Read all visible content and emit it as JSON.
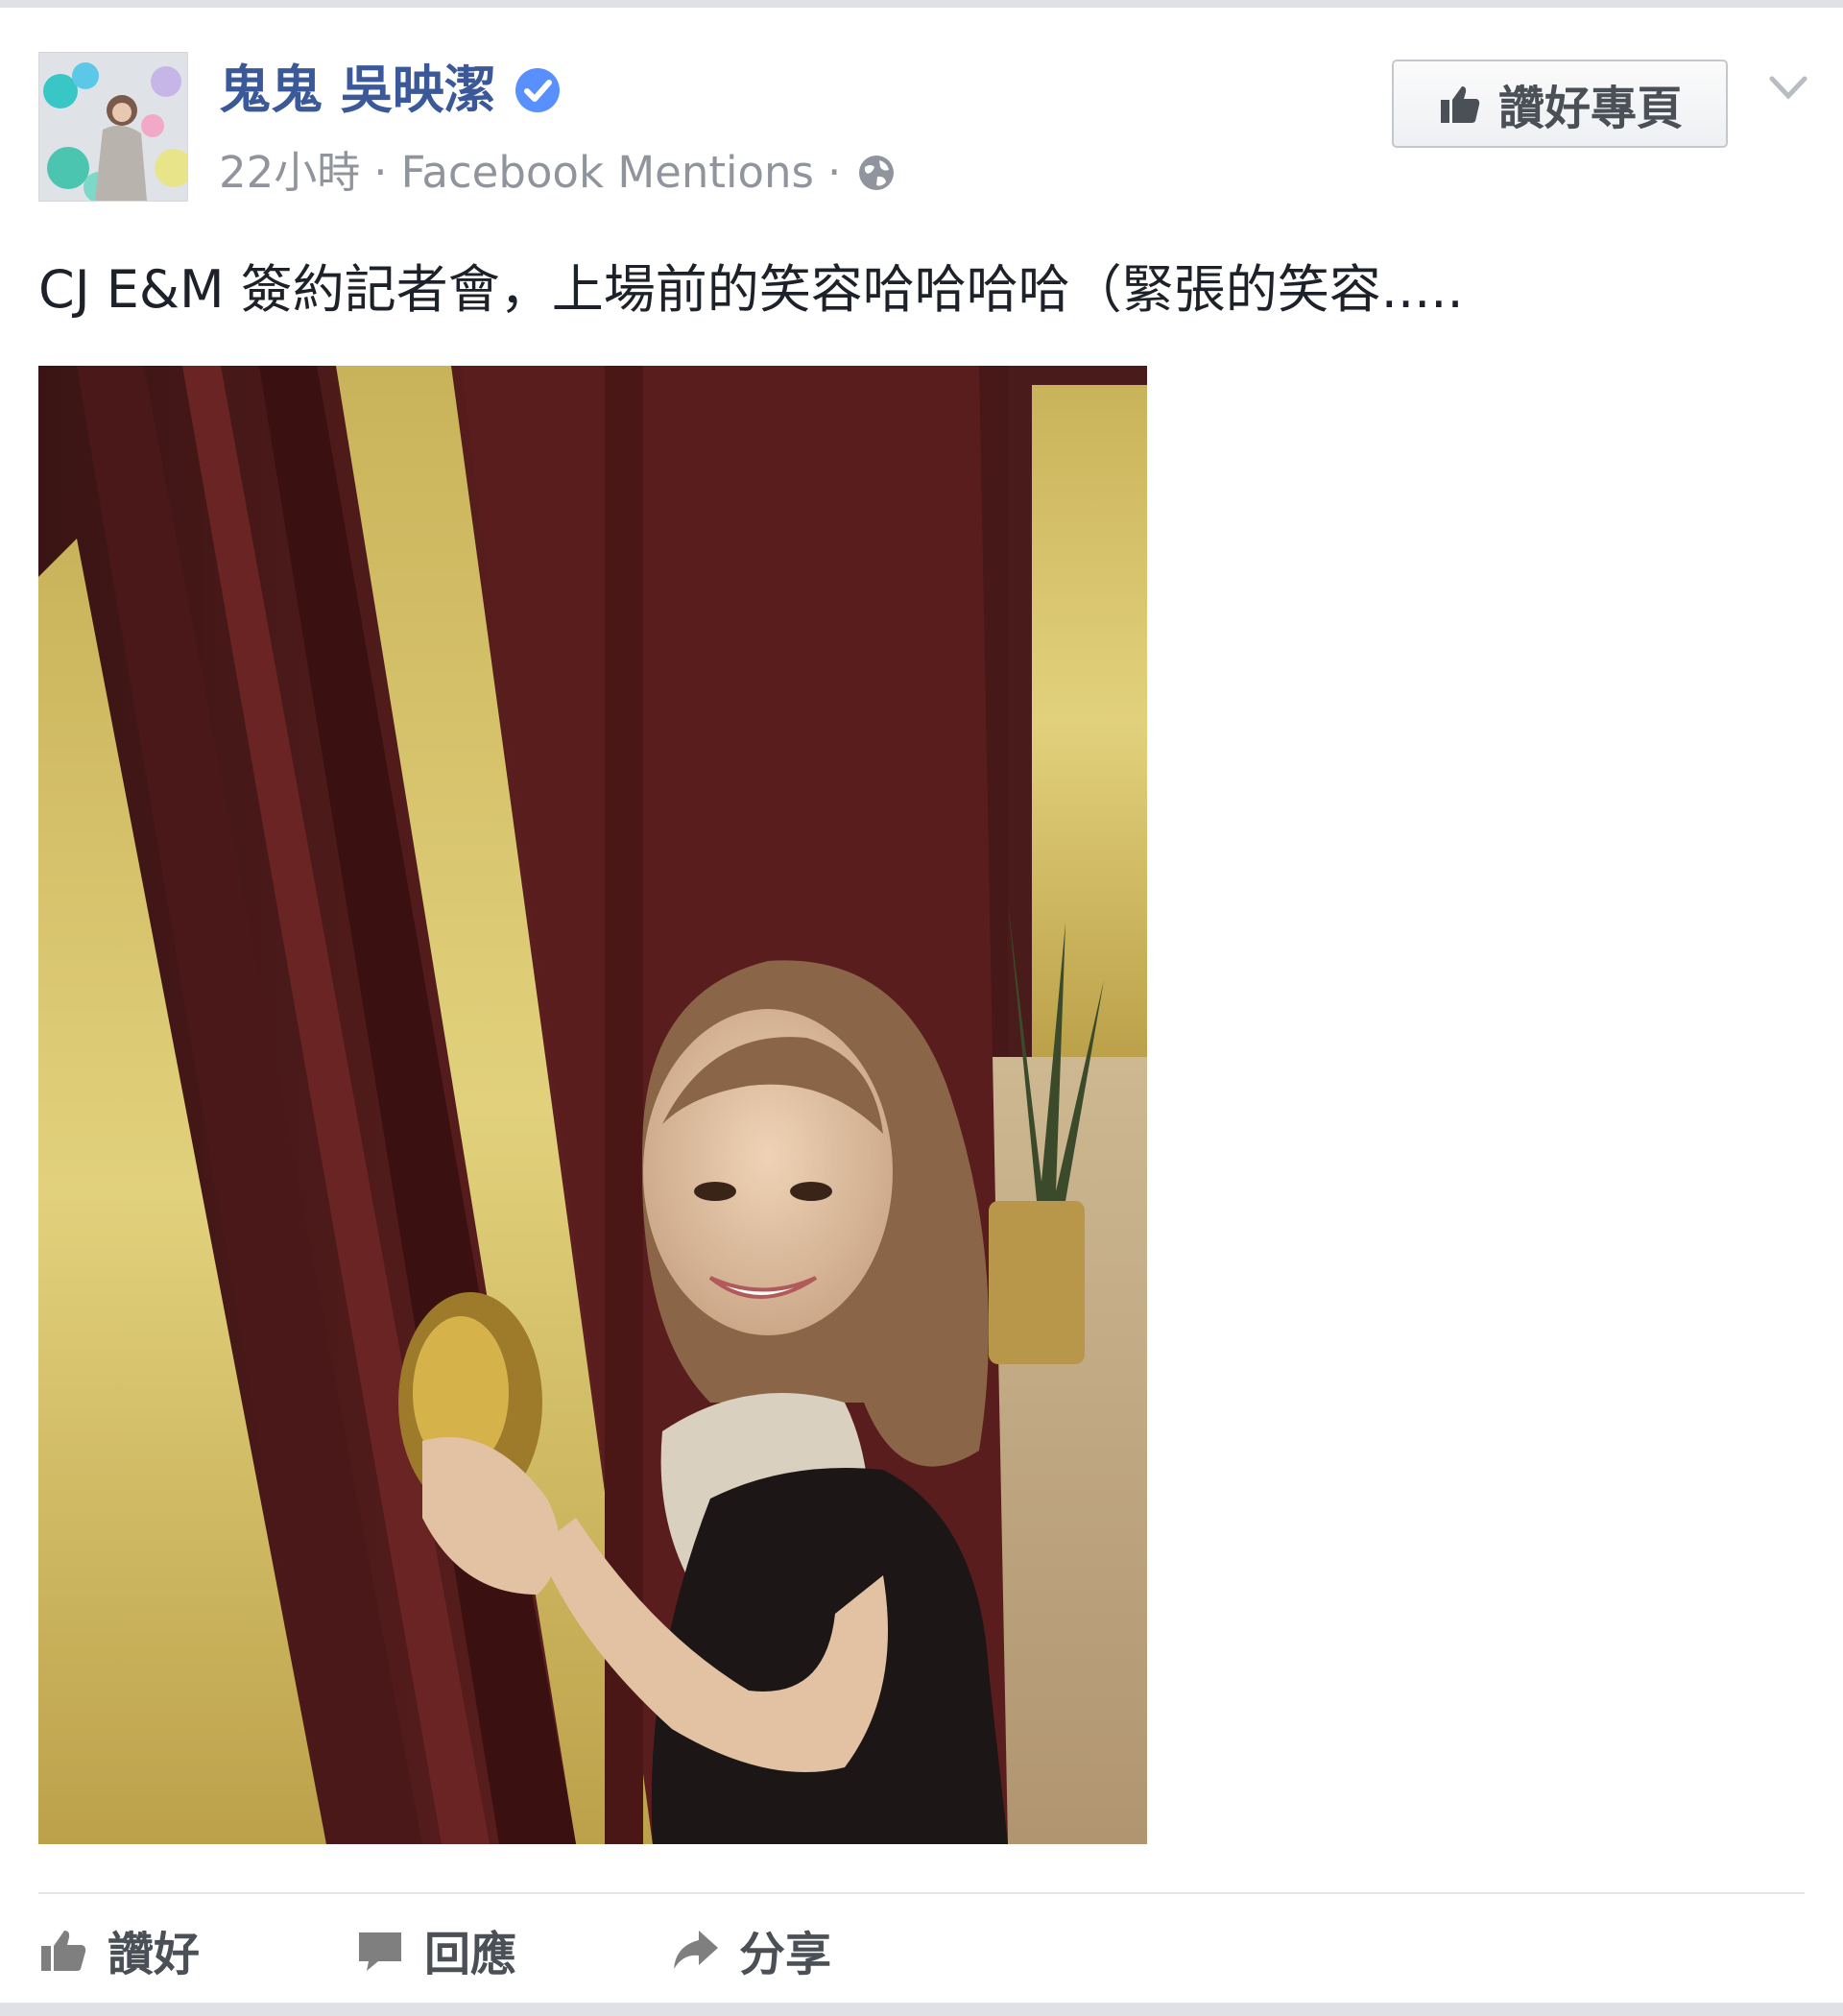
{
  "post": {
    "author": {
      "name": "鬼鬼 吳映潔",
      "verified": true
    },
    "meta": {
      "time": "22小時",
      "separator": "·",
      "source": "Facebook Mentions",
      "privacy_icon": "globe-icon"
    },
    "like_page_button": {
      "label": "讚好專頁",
      "icon": "thumbs-up-icon"
    },
    "menu_icon": "chevron-down-icon",
    "text": "CJ E&M 簽約記者會，上場前的笑容哈哈哈哈（緊張的笑容.....",
    "actions": {
      "like": {
        "label": "讚好",
        "icon": "thumbs-up-icon"
      },
      "comment": {
        "label": "回應",
        "icon": "comment-bubble-icon"
      },
      "share": {
        "label": "分享",
        "icon": "share-arrow-icon"
      }
    }
  },
  "colors": {
    "author_link": "#3b5998",
    "meta_text": "#90949c",
    "body_text": "#1d2129",
    "action_text": "#4b4f56",
    "verified_badge": "#5890ff"
  }
}
